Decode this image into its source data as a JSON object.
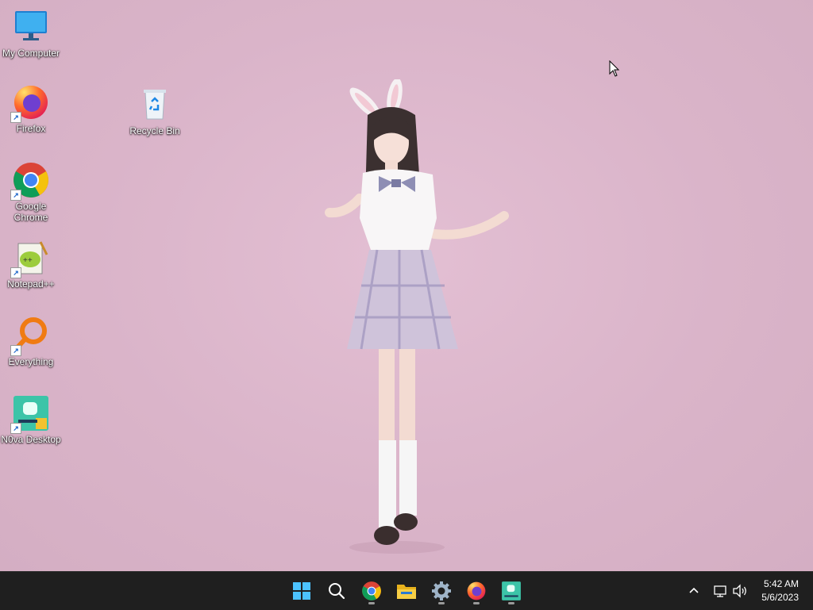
{
  "desktop": {
    "icons": [
      {
        "label": "My Computer",
        "icon": "monitor-icon"
      },
      {
        "label": "Recycle Bin",
        "icon": "recycle-bin-icon"
      },
      {
        "label": "Firefox",
        "icon": "firefox-icon"
      },
      {
        "label": "Google Chrome",
        "icon": "chrome-icon"
      },
      {
        "label": "Notepad++",
        "icon": "notepad-plus-plus-icon"
      },
      {
        "label": "Everything",
        "icon": "everything-search-icon"
      },
      {
        "label": "N0va Desktop",
        "icon": "n0va-desktop-icon"
      }
    ]
  },
  "taskbar": {
    "apps": [
      {
        "name": "Start",
        "icon": "windows-start-icon"
      },
      {
        "name": "Search",
        "icon": "search-icon"
      },
      {
        "name": "Google Chrome",
        "icon": "chrome-icon"
      },
      {
        "name": "File Explorer",
        "icon": "file-explorer-icon"
      },
      {
        "name": "Settings",
        "icon": "gear-icon"
      },
      {
        "name": "Firefox",
        "icon": "firefox-icon"
      },
      {
        "name": "N0va Desktop",
        "icon": "n0va-desktop-icon"
      }
    ],
    "tray": {
      "time": "5:42 AM",
      "date": "5/6/2023"
    }
  },
  "colors": {
    "wallpaper": "#dcb6cb",
    "taskbar": "#1f1f1f"
  }
}
